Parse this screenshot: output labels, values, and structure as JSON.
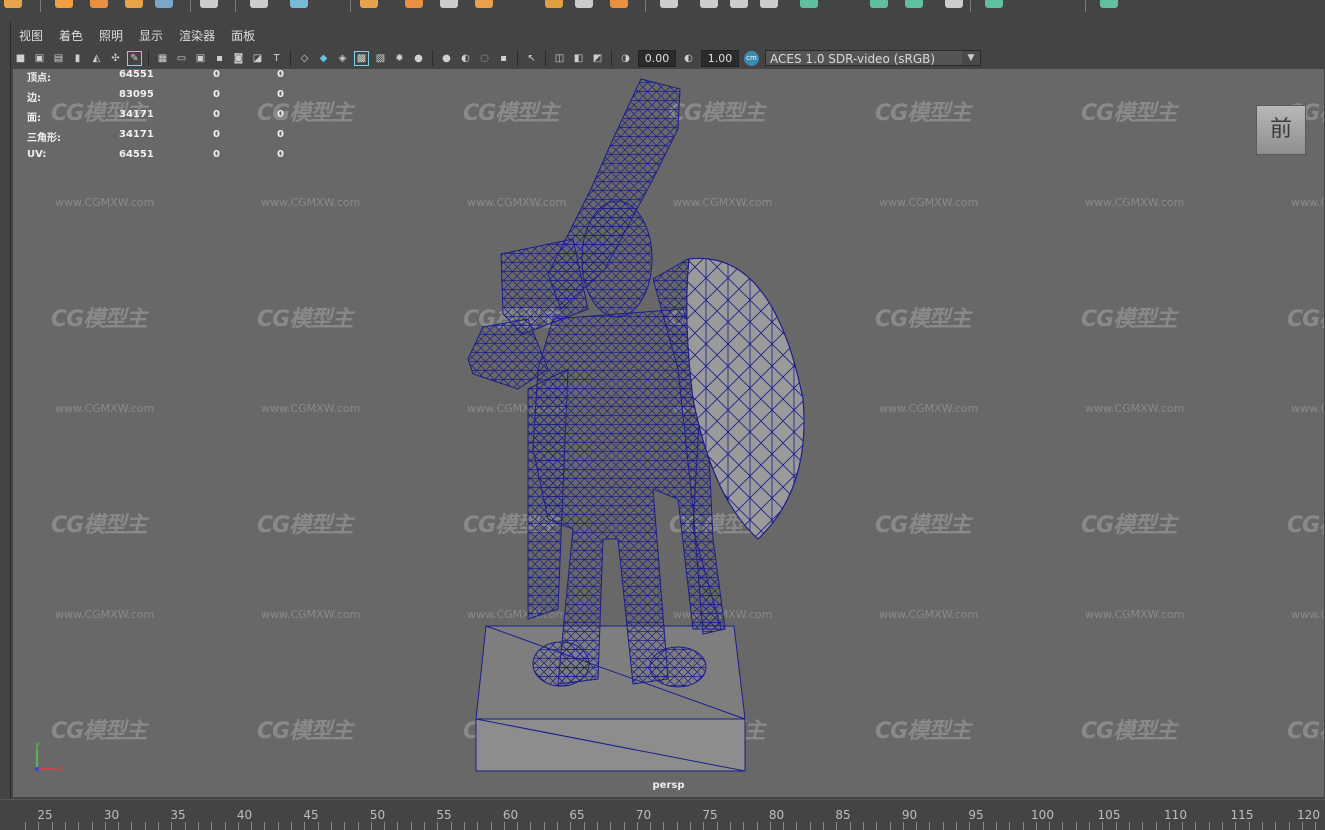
{
  "menu": [
    "视图",
    "着色",
    "照明",
    "显示",
    "渲染器",
    "面板"
  ],
  "toolbar": {
    "exposure_value": "0.00",
    "gamma_value": "1.00",
    "color_space": "ACES 1.0 SDR-video (sRGB)"
  },
  "hud": {
    "rows": [
      {
        "label": "顶点:",
        "v1": "64551",
        "v2": "0",
        "v3": "0"
      },
      {
        "label": "边:",
        "v1": "83095",
        "v2": "0",
        "v3": "0"
      },
      {
        "label": "面:",
        "v1": "34171",
        "v2": "0",
        "v3": "0"
      },
      {
        "label": "三角形:",
        "v1": "34171",
        "v2": "0",
        "v3": "0"
      },
      {
        "label": "UV:",
        "v1": "64551",
        "v2": "0",
        "v3": "0"
      }
    ]
  },
  "view_cube_label": "前",
  "camera_label": "persp",
  "axis": {
    "y": "y",
    "x": "x"
  },
  "watermark": {
    "logo": "CG模型主",
    "url": "www.CGMXW.com"
  },
  "timeline_ticks": [
    "25",
    "30",
    "35",
    "40",
    "45",
    "50",
    "55",
    "60",
    "65",
    "70",
    "75",
    "80",
    "85",
    "90",
    "95",
    "100",
    "105",
    "110",
    "115",
    "120"
  ],
  "colors": {
    "viewport_bg": "#686868",
    "wireframe": "#1b1e8a",
    "ui_bg": "#444444"
  },
  "icons": [
    "camera-icon",
    "grid-icon",
    "wireframe-icon",
    "shaded-icon",
    "light-icon",
    "isolate-icon",
    "exposure-icon",
    "gamma-icon",
    "color-management-icon"
  ]
}
